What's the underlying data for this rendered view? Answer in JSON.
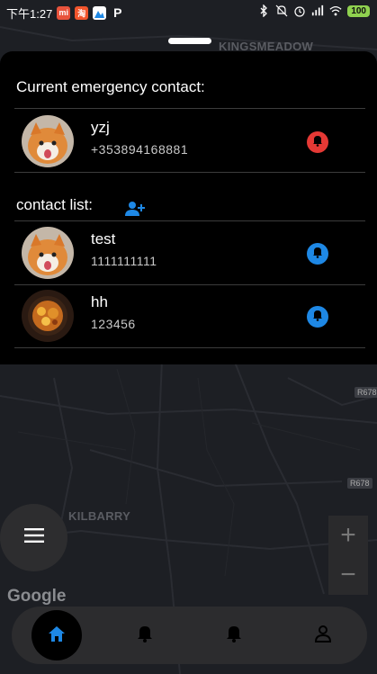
{
  "status_bar": {
    "time": "下午1:27",
    "app_icons": [
      "mi-app-icon",
      "taobao-icon",
      "gallery-icon",
      "parking-app-icon"
    ],
    "battery": "100"
  },
  "map": {
    "labels": {
      "kingsmeadow": "KINGSMEADOW",
      "kilbarry": "KILBARRY"
    },
    "road_badges": {
      "r678_top": "R678",
      "r678_bottom": "R678"
    },
    "attribution": "Google"
  },
  "sheet": {
    "current_title": "Current emergency contact:",
    "current_contact": {
      "name": "yzj",
      "phone": "+353894168881",
      "bell_color": "#e53935"
    },
    "list_title": "contact list:",
    "contacts": [
      {
        "name": "test",
        "phone": "1111111111",
        "bell_color": "#1e88e5"
      },
      {
        "name": "hh",
        "phone": "123456",
        "bell_color": "#1e88e5"
      }
    ]
  },
  "zoom": {
    "in": "+",
    "out": "−"
  },
  "nav": {
    "items": [
      "home-icon",
      "bell-icon",
      "bell-icon",
      "person-icon"
    ],
    "active": "home"
  },
  "colors": {
    "accent_blue": "#1e88e5",
    "alert_red": "#e53935",
    "battery_green": "#8fd14f"
  }
}
